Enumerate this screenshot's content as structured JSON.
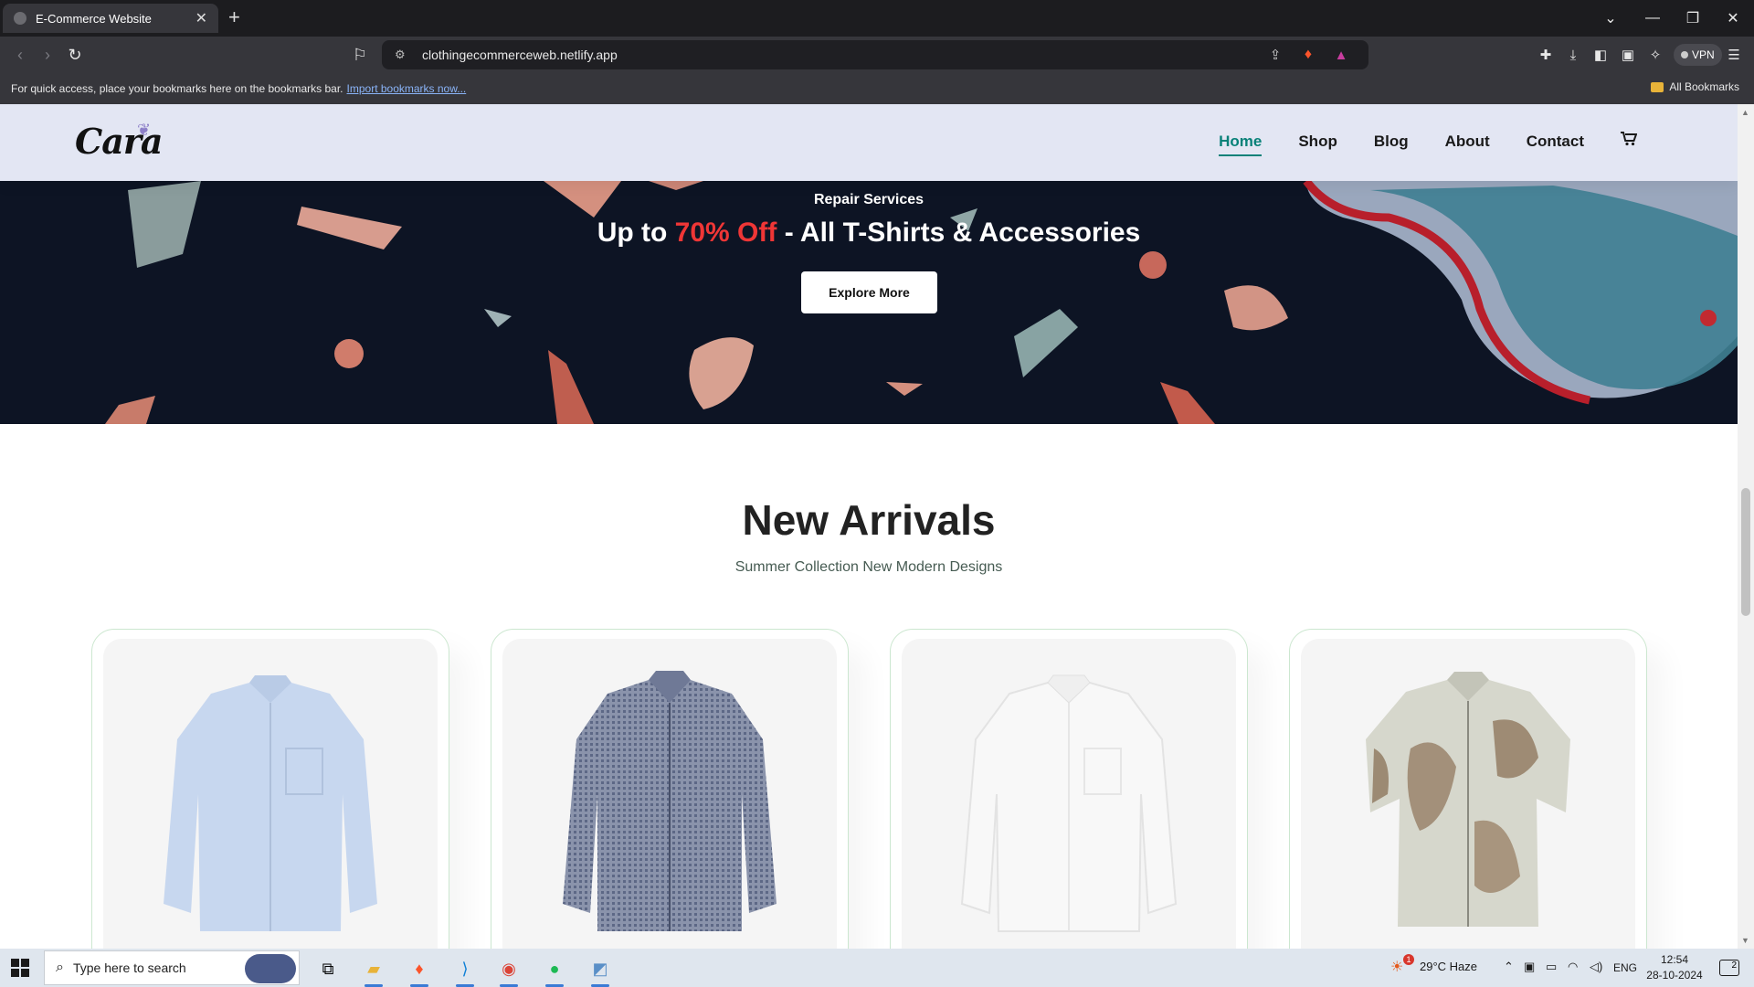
{
  "browser": {
    "tab_title": "E-Commerce Website",
    "url": "clothingecommerceweb.netlify.app",
    "bookmarks_prompt": "For quick access, place your bookmarks here on the bookmarks bar.",
    "bookmarks_link": "Import bookmarks now...",
    "all_bookmarks": "All Bookmarks",
    "vpn_label": "VPN"
  },
  "site": {
    "logo": "Cara",
    "nav": [
      {
        "label": "Home",
        "active": true
      },
      {
        "label": "Shop"
      },
      {
        "label": "Blog"
      },
      {
        "label": "About"
      },
      {
        "label": "Contact"
      }
    ],
    "banner": {
      "kicker": "Repair Services",
      "headline_before": "Up to ",
      "headline_highlight": "70% Off",
      "headline_after": " - All T-Shirts & Accessories",
      "button": "Explore More"
    },
    "section": {
      "title": "New Arrivals",
      "subtitle": "Summer Collection New Modern Designs"
    },
    "products": [
      {
        "name": "light-blue-shirt"
      },
      {
        "name": "navy-check-shirt"
      },
      {
        "name": "white-shirt"
      },
      {
        "name": "floral-shirt"
      }
    ]
  },
  "taskbar": {
    "search_placeholder": "Type here to search",
    "weather": "29°C  Haze",
    "language": "ENG",
    "time": "12:54",
    "date": "28-10-2024",
    "notification_count": "2",
    "weather_badge": "1"
  },
  "colors": {
    "accent": "#088178",
    "header_bg": "#e3e6f3",
    "banner_bg": "#0d1424",
    "highlight": "#ef3636"
  }
}
